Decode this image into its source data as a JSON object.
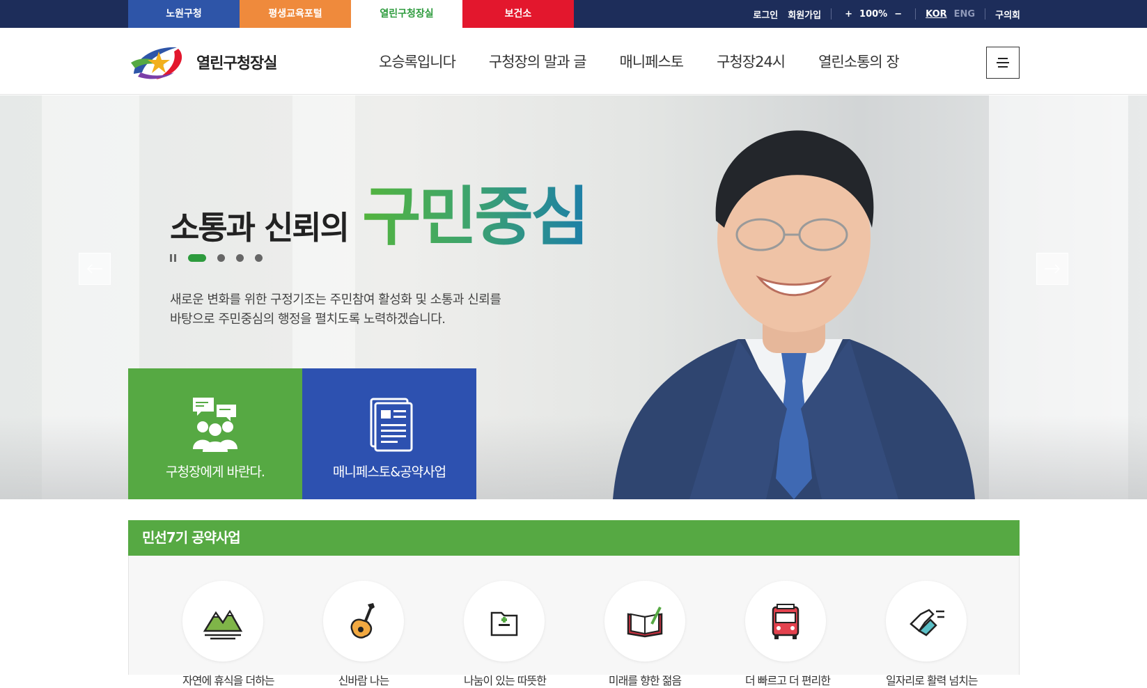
{
  "site_tabs": [
    {
      "label": "노원구청",
      "color": "#2e55a8",
      "text_color": "#ffffff"
    },
    {
      "label": "평생교육포털",
      "color": "#ef8a3c",
      "text_color": "#ffffff"
    },
    {
      "label": "열린구청장실",
      "color": "#ffffff",
      "text_color": "#2d9b3d"
    },
    {
      "label": "보건소",
      "color": "#e3172d",
      "text_color": "#ffffff"
    }
  ],
  "utility": {
    "login": "로그인",
    "join": "회원가입",
    "zoom_in": "+",
    "zoom_level": "100%",
    "zoom_out": "−",
    "lang_kor": "KOR",
    "lang_eng": "ENG",
    "council": "구의회"
  },
  "header": {
    "logo_text": "열린구청장실",
    "nav": [
      "오승록입니다",
      "구청장의 말과 글",
      "매니페스토",
      "구청장24시",
      "열린소통의 장"
    ]
  },
  "hero": {
    "lead": "소통과 신뢰의",
    "headline": "구민중심",
    "desc_line1": "새로운 변화를 위한 구정기조는 주민참여 활성화 및 소통과 신뢰를",
    "desc_line2": "바탕으로 주민중심의 행정을 펼치도록 노력하겠습니다.",
    "slide_count": 4,
    "active_slide": 1
  },
  "quick_boxes": [
    {
      "label": "구청장에게 바란다.",
      "icon": "people-chat-icon",
      "color": "#56a943"
    },
    {
      "label": "매니페스토&공약사업",
      "icon": "document-icon",
      "color": "#2d51b0"
    }
  ],
  "pledge": {
    "title": "민선7기 공약사업",
    "items": [
      {
        "label": "자연에 휴식을 더하는",
        "icon": "mountain-icon"
      },
      {
        "label": "신바람 나는",
        "icon": "guitar-icon"
      },
      {
        "label": "나눔이 있는 따뜻한",
        "icon": "medical-folder-icon"
      },
      {
        "label": "미래를 향한 젊음",
        "icon": "book-pen-icon"
      },
      {
        "label": "더 빠르고 더 편리한",
        "icon": "bus-icon"
      },
      {
        "label": "일자리로 활력 넘치는",
        "icon": "handshake-icon"
      }
    ]
  }
}
